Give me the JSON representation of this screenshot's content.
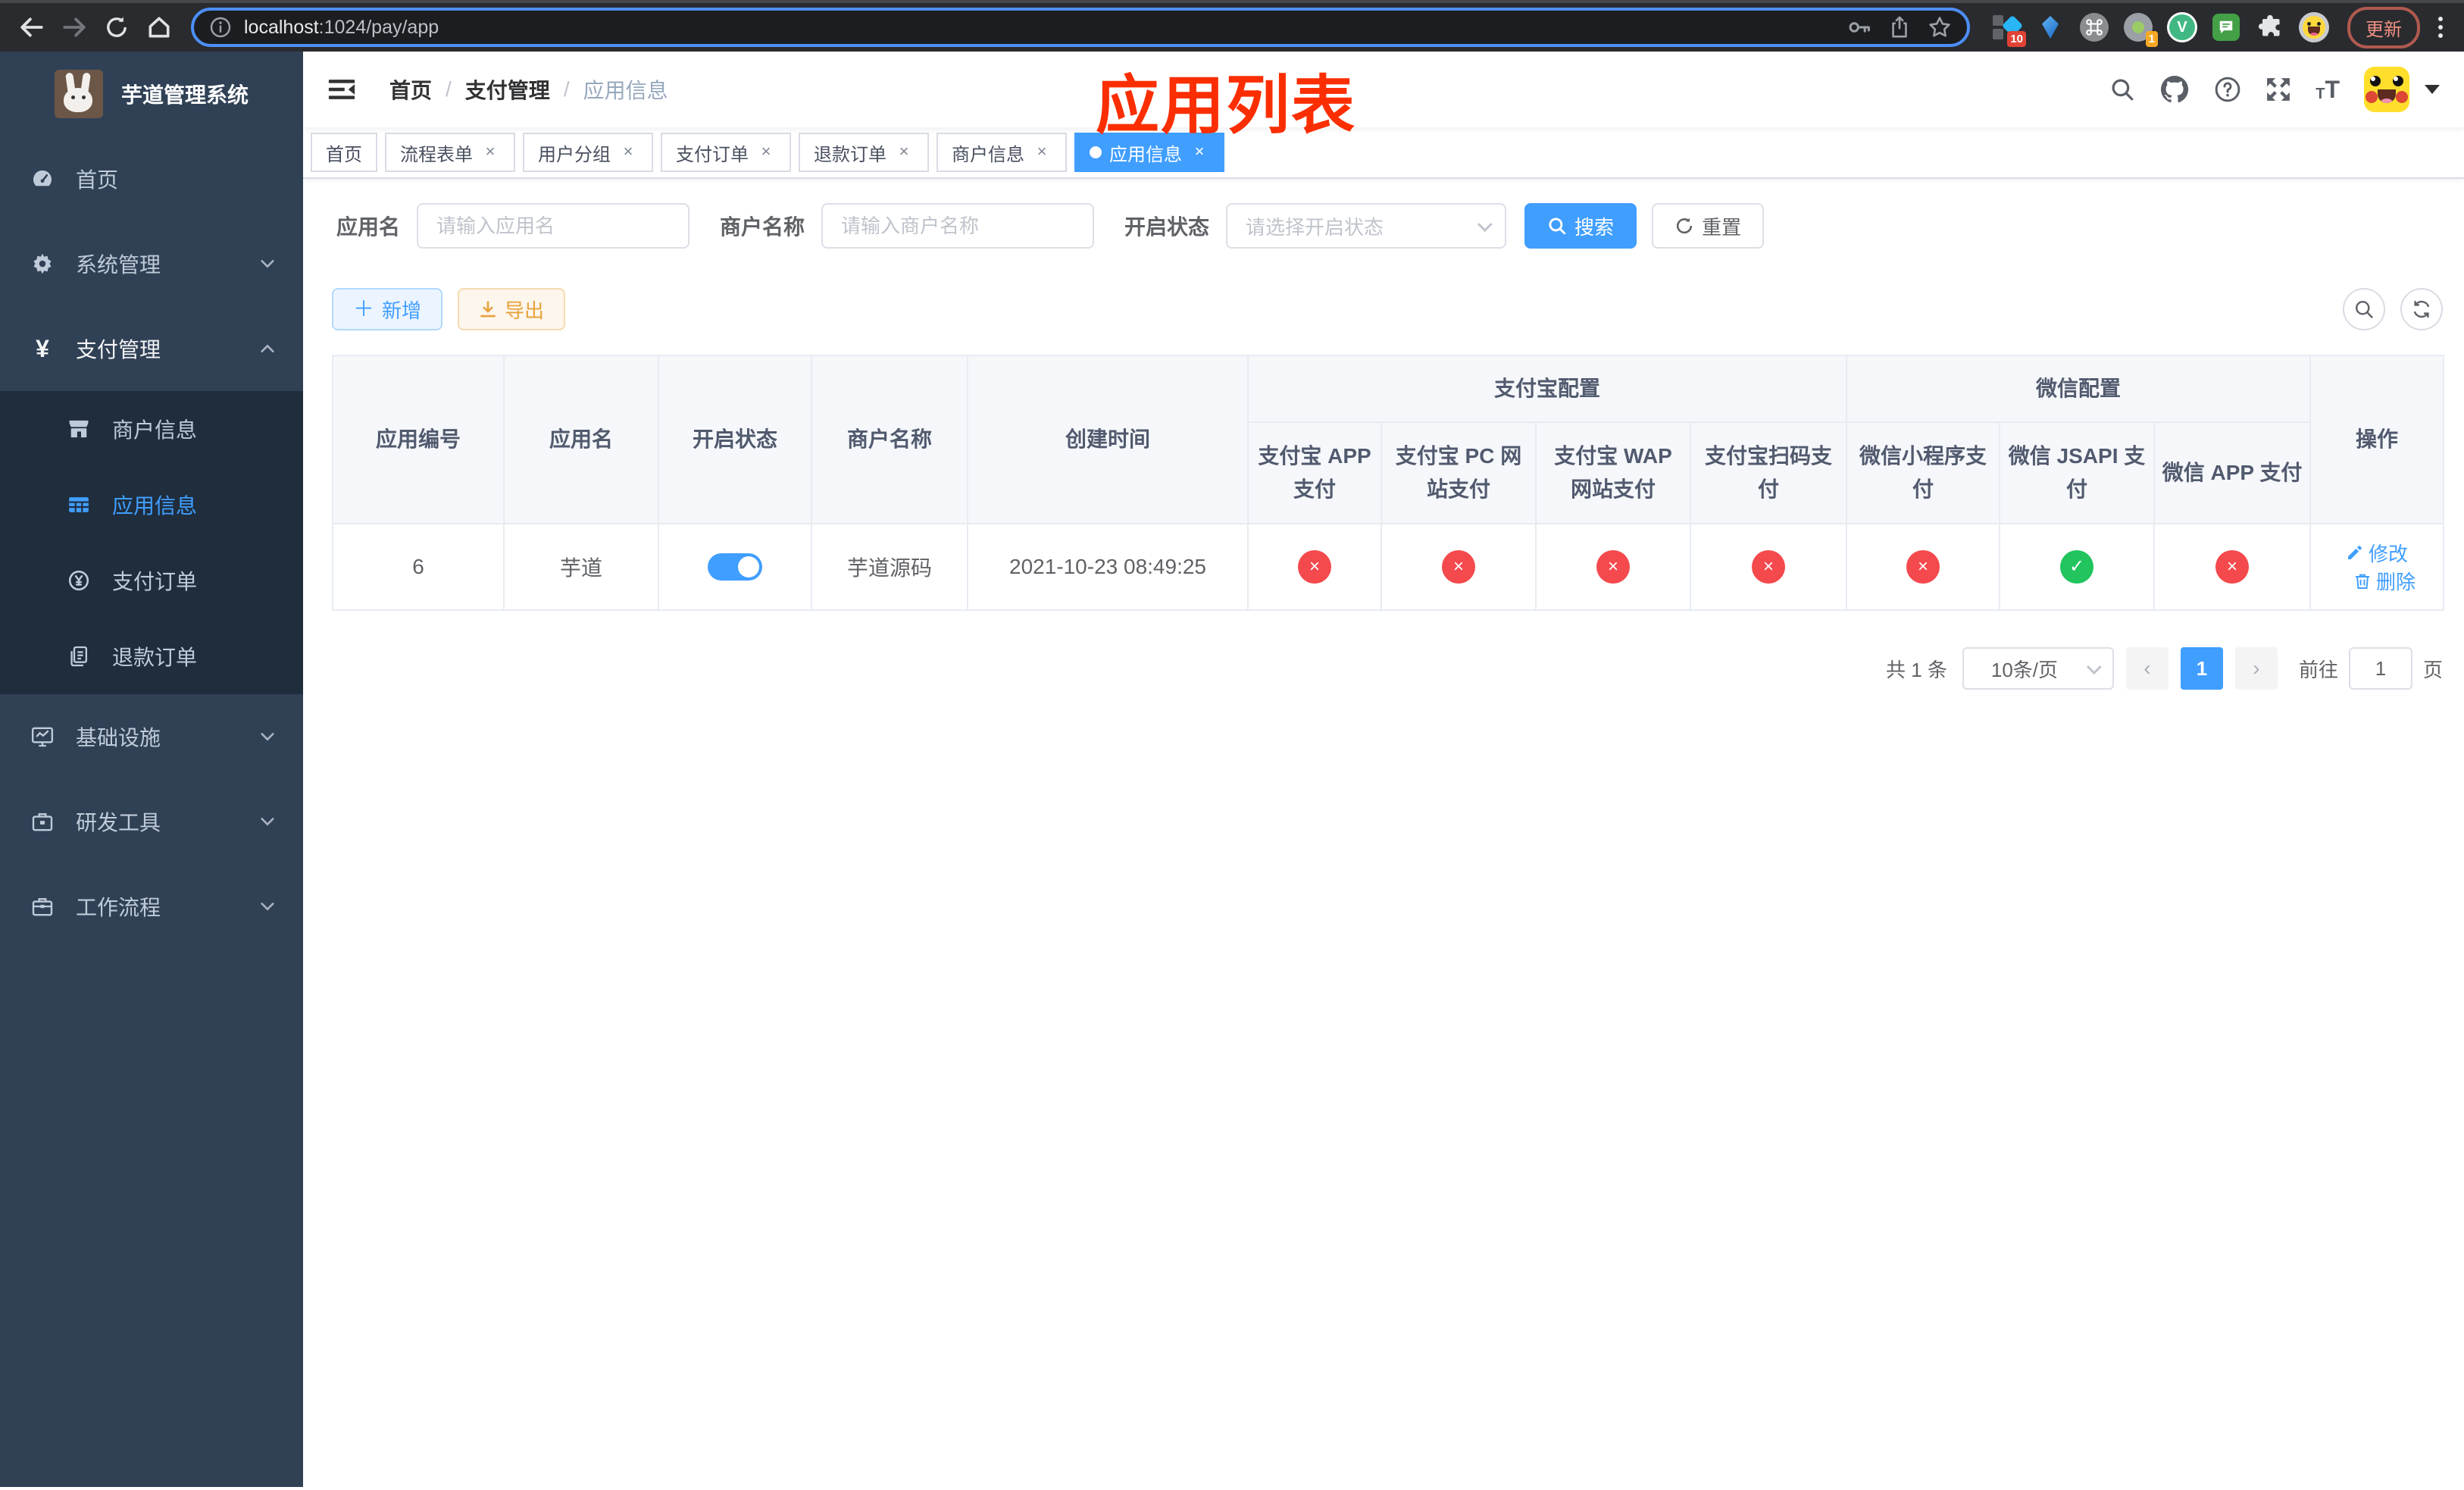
{
  "browser": {
    "url": {
      "host": "localhost",
      "path": ":1024/pay/app"
    },
    "update_button": "更新",
    "extension_badge_a": "10",
    "extension_badge_b": "1",
    "vue_letter": "V"
  },
  "sidebar": {
    "title": "芋道管理系统",
    "menu": [
      {
        "label": "首页"
      },
      {
        "label": "系统管理"
      },
      {
        "label": "支付管理"
      },
      {
        "label": "商户信息"
      },
      {
        "label": "应用信息"
      },
      {
        "label": "支付订单"
      },
      {
        "label": "退款订单"
      },
      {
        "label": "基础设施"
      },
      {
        "label": "研发工具"
      },
      {
        "label": "工作流程"
      }
    ]
  },
  "navbar": {
    "breadcrumb": [
      "首页",
      "支付管理",
      "应用信息"
    ]
  },
  "annotation": {
    "text": "应用列表",
    "color": "#fb2e01"
  },
  "tabs": [
    {
      "label": "首页"
    },
    {
      "label": "流程表单"
    },
    {
      "label": "用户分组"
    },
    {
      "label": "支付订单"
    },
    {
      "label": "退款订单"
    },
    {
      "label": "商户信息"
    },
    {
      "label": "应用信息"
    }
  ],
  "filters": {
    "app_name_label": "应用名",
    "app_name_placeholder": "请输入应用名",
    "merchant_label": "商户名称",
    "merchant_placeholder": "请输入商户名称",
    "status_label": "开启状态",
    "status_placeholder": "请选择开启状态",
    "search_label": "搜索",
    "reset_label": "重置"
  },
  "toolbar": {
    "add_label": "新增",
    "export_label": "导出"
  },
  "table": {
    "headers": {
      "app_id": "应用编号",
      "app_name": "应用名",
      "status": "开启状态",
      "merchant": "商户名称",
      "created": "创建时间",
      "alipay_group": "支付宝配置",
      "wechat_group": "微信配置",
      "alipay_app": "支付宝 APP 支付",
      "alipay_pc": "支付宝 PC 网站支付",
      "alipay_wap": "支付宝 WAP 网站支付",
      "alipay_qr": "支付宝扫码支付",
      "wechat_mini": "微信小程序支付",
      "wechat_jsapi": "微信 JSAPI 支付",
      "wechat_app": "微信 APP 支付",
      "actions": "操作"
    },
    "row": {
      "app_id": "6",
      "app_name": "芋道",
      "enabled": true,
      "merchant": "芋道源码",
      "created_at": "2021-10-23 08:49:25",
      "channel_status": [
        false,
        false,
        false,
        false,
        false,
        true,
        false
      ],
      "edit_label": "修改",
      "delete_label": "删除"
    }
  },
  "pagination": {
    "total": "共 1 条",
    "page_size": "10条/页",
    "current_page": "1",
    "goto_label": "前往",
    "goto_value": "1",
    "unit_label": "页"
  },
  "colors": {
    "primary": "#409eff",
    "success": "#21c45d",
    "danger": "#f4494d",
    "annotation": "#fb2e01",
    "sidebar_bg": "#304156",
    "submenu_bg": "#1f2d3d"
  }
}
